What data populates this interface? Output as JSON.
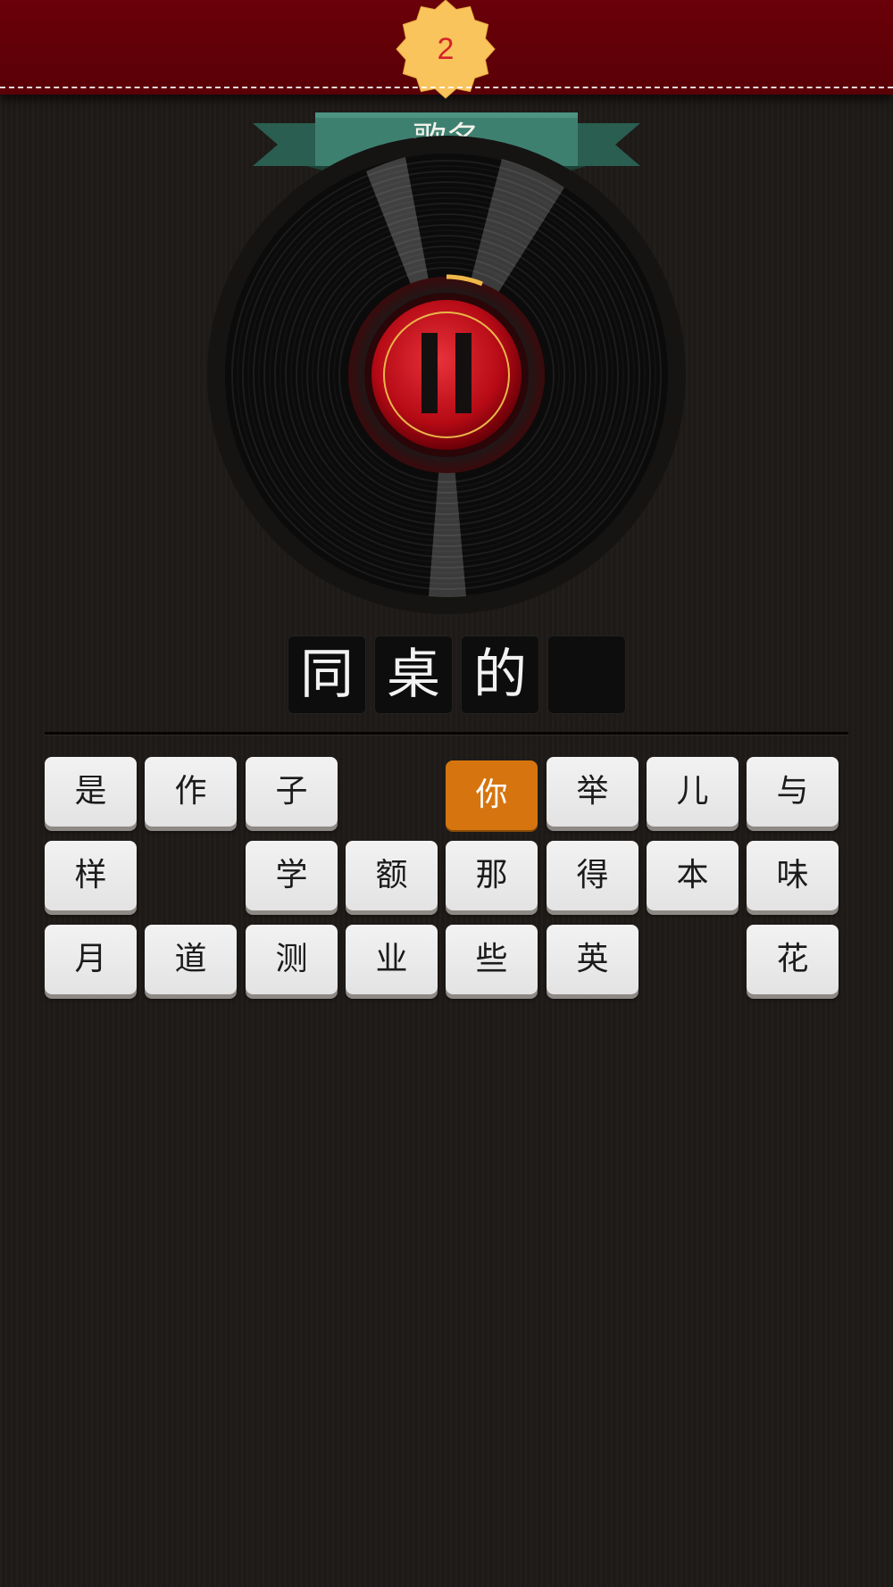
{
  "level": {
    "number": "2"
  },
  "category": {
    "label": "歌名"
  },
  "player": {
    "state": "paused",
    "control_icon": "pause-icon"
  },
  "answer": {
    "slots": [
      "同",
      "桌",
      "的",
      ""
    ]
  },
  "keys": [
    {
      "char": "是",
      "row": 0,
      "col": 0,
      "state": "normal"
    },
    {
      "char": "作",
      "row": 0,
      "col": 1,
      "state": "normal"
    },
    {
      "char": "子",
      "row": 0,
      "col": 2,
      "state": "normal"
    },
    {
      "char": "你",
      "row": 0,
      "col": 4,
      "state": "selected"
    },
    {
      "char": "举",
      "row": 0,
      "col": 5,
      "state": "normal"
    },
    {
      "char": "儿",
      "row": 0,
      "col": 6,
      "state": "normal"
    },
    {
      "char": "与",
      "row": 0,
      "col": 7,
      "state": "normal"
    },
    {
      "char": "样",
      "row": 1,
      "col": 0,
      "state": "normal"
    },
    {
      "char": "学",
      "row": 1,
      "col": 2,
      "state": "normal"
    },
    {
      "char": "额",
      "row": 1,
      "col": 3,
      "state": "normal"
    },
    {
      "char": "那",
      "row": 1,
      "col": 4,
      "state": "normal"
    },
    {
      "char": "得",
      "row": 1,
      "col": 5,
      "state": "normal"
    },
    {
      "char": "本",
      "row": 1,
      "col": 6,
      "state": "normal"
    },
    {
      "char": "味",
      "row": 1,
      "col": 7,
      "state": "normal"
    },
    {
      "char": "月",
      "row": 2,
      "col": 0,
      "state": "normal"
    },
    {
      "char": "道",
      "row": 2,
      "col": 1,
      "state": "normal"
    },
    {
      "char": "测",
      "row": 2,
      "col": 2,
      "state": "normal"
    },
    {
      "char": "业",
      "row": 2,
      "col": 3,
      "state": "normal"
    },
    {
      "char": "些",
      "row": 2,
      "col": 4,
      "state": "normal"
    },
    {
      "char": "英",
      "row": 2,
      "col": 5,
      "state": "normal"
    },
    {
      "char": "花",
      "row": 2,
      "col": 7,
      "state": "normal"
    }
  ],
  "colors": {
    "banner": "#6a0009",
    "badge": "#f9c45c",
    "ribbon": "#3e8070",
    "selected_key": "#d6750f",
    "record_center": "#c8101c"
  }
}
